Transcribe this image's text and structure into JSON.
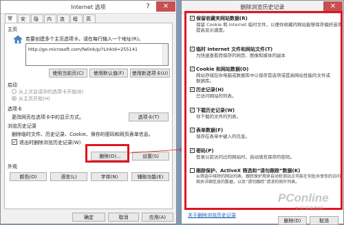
{
  "left_window": {
    "title": "Internet 选项",
    "tabs": [
      "常规",
      "安全",
      "隐私",
      "内容",
      "连接",
      "程序",
      "高级"
    ],
    "homepage": {
      "group_label": "主页",
      "description": "若要创建多个主页选项卡，请在每行输入一个地址(R)。",
      "url": "http://go.microsoft.com/fwlink/p/?LinkId=255141",
      "buttons": [
        "使用当前页(C)",
        "使用默认值(F)",
        "使用新选项卡(U)"
      ]
    },
    "startup": {
      "group_label": "启动",
      "option1": "从上次会话中的选项卡开始(B)",
      "option2": "从主页开始(H)"
    },
    "tabs_section": {
      "group_label": "选项卡",
      "description": "更改网页在选项卡中的显示方式。",
      "button": "选项卡(T)"
    },
    "history": {
      "group_label": "浏览历史记录",
      "description": "删除临时文件、历史记录、Cookie、保存的密码和网页表单信息。",
      "checkbox": "退出时删除浏览历史记录(W)",
      "checked": true,
      "delete_button": "删除(D)...",
      "settings_button": "设置(S)"
    },
    "appearance": {
      "group_label": "外观",
      "buttons": [
        "颜色(O)",
        "语言(L)",
        "字体(N)",
        "辅助功能(E)"
      ]
    },
    "footer_buttons": [
      "确定",
      "取消",
      "应用(A)"
    ]
  },
  "right_window": {
    "title": "删除浏览历史记录",
    "options": [
      {
        "title": "保留收藏夹网站数据(R)",
        "desc": [
          "保留 Cookie 和 Internet 临时文件，以便你收藏的网站能够保存偏好选项",
          "提高显示速度。"
        ],
        "checked": true
      },
      {
        "title": "临时 Internet 文件和网站文件(T)",
        "desc": [
          "为快速查看而保存的网页、图像和媒体的副本"
        ],
        "checked": true
      },
      {
        "title": "Cookie 和网站数据(O)",
        "desc": [
          "网站存储在你电脑或数据库中以保存首选项或提高网站性能的文件或",
          "数据库。"
        ],
        "checked": true
      },
      {
        "title": "历史记录(H)",
        "desc": [
          "已访问网站的列表。"
        ],
        "checked": true
      },
      {
        "title": "下载历史记录(W)",
        "desc": [
          "你下载的文件的列表。"
        ],
        "checked": true
      },
      {
        "title": "表单数据(F)",
        "desc": [
          "保存在表单中键入的信息。"
        ],
        "checked": true
      },
      {
        "title": "密码(P)",
        "desc": [
          "登录以前访问过的网站时，自动填充保存的密码。"
        ],
        "checked": true
      },
      {
        "title": "跟踪保护、ActiveX 筛选和“请勿跟踪”数据(K)",
        "desc": [
          "从筛选中排除的网站列表、跟踪保护用来自动检测站点可能在何处共享你的访问",
          "相关详细信息的数据，以及“请勿跟踪”请求的例外列表。"
        ],
        "checked": false
      }
    ],
    "link": "关于删除浏览历史记录",
    "delete_button": "删除(D)",
    "cancel_button": "取消"
  },
  "watermark": "PConline",
  "watermark_sub": "太平洋电脑网",
  "colors": {
    "highlight": "#e0141e",
    "link": "#1a5fb4"
  }
}
